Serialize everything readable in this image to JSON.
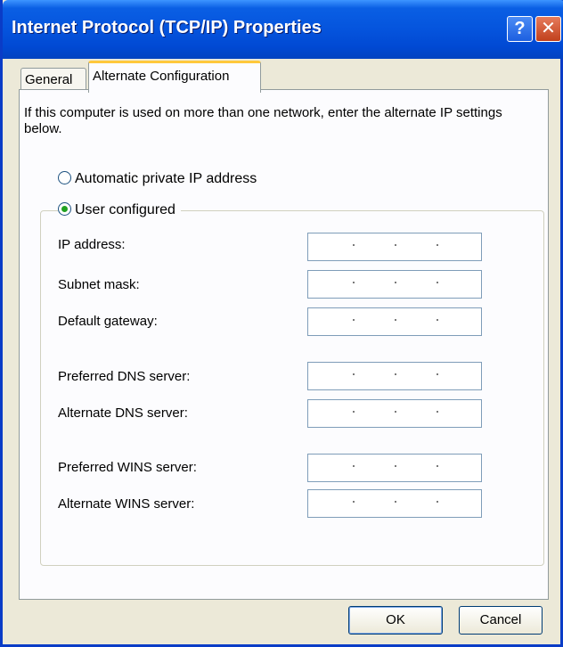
{
  "window": {
    "title": "Internet Protocol (TCP/IP) Properties",
    "help_label": "?",
    "close_label": "✕"
  },
  "tabs": [
    {
      "label": "General",
      "selected": false
    },
    {
      "label": "Alternate Configuration",
      "selected": true
    }
  ],
  "description": "If this computer is used on more than one network, enter the alternate IP settings below.",
  "options": {
    "automatic": {
      "label": "Automatic private IP address",
      "checked": false
    },
    "user": {
      "label": "User configured",
      "checked": true
    }
  },
  "fields": [
    {
      "label": "IP address:",
      "value": ""
    },
    {
      "label": "Subnet mask:",
      "value": ""
    },
    {
      "label": "Default gateway:",
      "value": ""
    },
    {
      "label": "Preferred DNS server:",
      "value": ""
    },
    {
      "label": "Alternate DNS server:",
      "value": ""
    },
    {
      "label": "Preferred WINS server:",
      "value": ""
    },
    {
      "label": "Alternate WINS server:",
      "value": ""
    }
  ],
  "buttons": {
    "ok": "OK",
    "cancel": "Cancel"
  },
  "colors": {
    "titlebar": "#0554dd",
    "dialog_bg": "#ece9d8",
    "tab_accent": "#ffc83c",
    "radio_dot": "#21a121"
  }
}
